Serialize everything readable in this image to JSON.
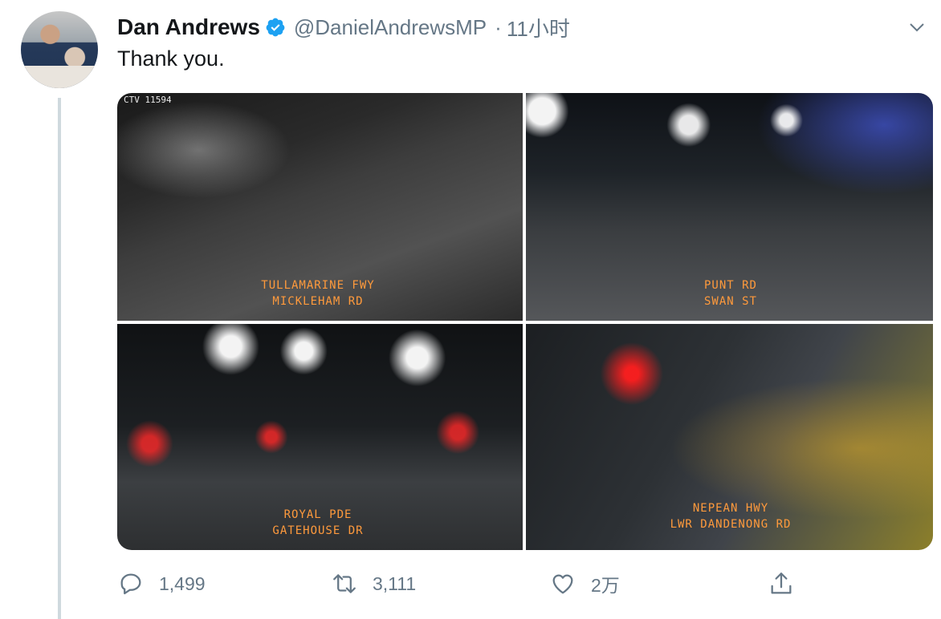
{
  "tweet": {
    "author_name": "Dan Andrews",
    "handle": "@DanielAndrewsMP",
    "separator": "·",
    "time": "11小时",
    "text": "Thank you."
  },
  "media": {
    "cameras": [
      {
        "id": "CTV 11594",
        "line1": "TULLAMARINE FWY",
        "line2": "MICKLEHAM RD"
      },
      {
        "id": "",
        "line1": "PUNT RD",
        "line2": "SWAN ST"
      },
      {
        "id": "",
        "line1": "ROYAL PDE",
        "line2": "GATEHOUSE DR"
      },
      {
        "id": "",
        "line1": "NEPEAN HWY",
        "line2": "LWR DANDENONG RD"
      }
    ]
  },
  "actions": {
    "reply_count": "1,499",
    "retweet_count": "3,111",
    "like_count": "2万"
  },
  "icons": {
    "verified": "verified-badge-icon",
    "menu": "chevron-down-icon",
    "reply": "reply-icon",
    "retweet": "retweet-icon",
    "like": "heart-icon",
    "share": "share-icon"
  },
  "colors": {
    "verified": "#1da1f2",
    "muted": "#657786",
    "text": "#14171a",
    "camera_label": "#ff9a3c"
  }
}
